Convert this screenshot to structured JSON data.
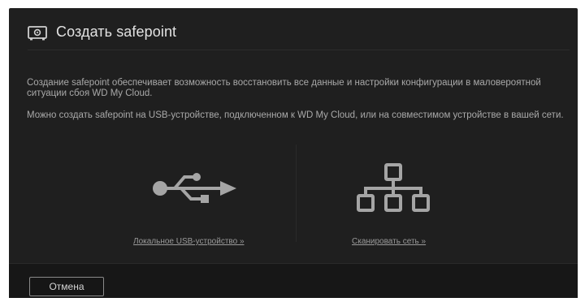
{
  "dialog": {
    "title": "Создать safepoint",
    "title_icon": "safe-icon",
    "description_1": "Создание safepoint обеспечивает возможность восстановить все данные и настройки конфигурации в маловероятной ситуации сбоя WD My Cloud.",
    "description_2": "Можно создать safepoint на USB-устройстве, подключенном к WD My Cloud, или на совместимом устройстве в вашей сети.",
    "options": [
      {
        "icon": "usb-icon",
        "label": "Локальное USB-устройство »"
      },
      {
        "icon": "network-icon",
        "label": "Сканировать сеть »"
      }
    ],
    "cancel_label": "Отмена"
  },
  "colors": {
    "dialog_bg": "#1f1f1f",
    "footer_bg": "#171717",
    "icon_gray": "#a5a5a5",
    "text": "#a9a9a9"
  }
}
